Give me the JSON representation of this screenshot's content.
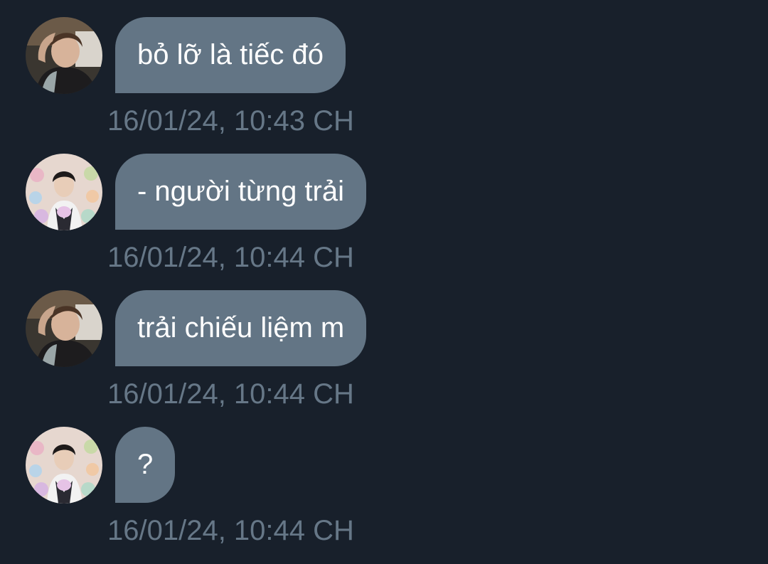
{
  "colors": {
    "background": "#18202b",
    "bubble": "#637585",
    "bubble_text": "#ffffff",
    "timestamp_text": "#667787"
  },
  "messages": [
    {
      "text": "bỏ lỡ là tiếc đó",
      "timestamp": "16/01/24, 10:43 CH",
      "avatar": "profile-photo-a"
    },
    {
      "text": "- người từng trải",
      "timestamp": "16/01/24, 10:44 CH",
      "avatar": "profile-photo-b"
    },
    {
      "text": "trải chiếu liệm m",
      "timestamp": "16/01/24, 10:44 CH",
      "avatar": "profile-photo-a"
    },
    {
      "text": "?",
      "timestamp": "16/01/24, 10:44 CH",
      "avatar": "profile-photo-b"
    }
  ]
}
